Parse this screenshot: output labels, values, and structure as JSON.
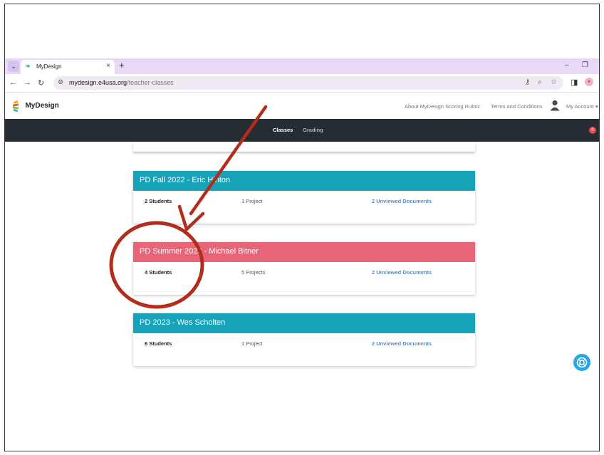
{
  "browser": {
    "tab_title": "MyDesign",
    "url_domain": "mydesign.e4usa.org",
    "url_path": "/teacher-classes",
    "new_tab": "+",
    "close_tab": "×",
    "tab_list": "⌄"
  },
  "site": {
    "logo_text": "MyDesign",
    "header_links": [
      "About MyDesign Scoring Rubric",
      "Terms and Conditions"
    ],
    "account_label": "My Account ▾"
  },
  "nav": {
    "classes": "Classes",
    "grading": "Grading",
    "notification_count": "0"
  },
  "classes": [
    {
      "name": "PD Fall 2022 - Eric Hinton",
      "students": "2 Students",
      "projects": "1 Project",
      "docs": "2 Unviewed Documents",
      "color": "#17a2b8"
    },
    {
      "name": "PD Summer 2023 - Michael Bitner",
      "students": "4 Students",
      "projects": "5 Projects",
      "docs": "2 Unviewed Documents",
      "color": "#e66677"
    },
    {
      "name": "PD 2023 - Wes Scholten",
      "students": "6 Students",
      "projects": "1 Project",
      "docs": "2 Unviewed Documents",
      "color": "#17a2b8"
    }
  ],
  "annotation": {
    "color": "#b32d1c",
    "shape": "arrow-and-circle"
  },
  "colors": {
    "navbar": "#252c33",
    "nav_active": "#ffffff",
    "nav_inactive": "#a9b1b8",
    "link": "#5a8fc4",
    "help": "#28a4e8"
  },
  "icons": [
    "tab-list-icon",
    "favicon-icon",
    "close-icon",
    "back-icon",
    "forward-icon",
    "reload-icon",
    "site-info-icon",
    "password-key-icon",
    "zoom-icon",
    "star-icon",
    "side-panel-icon",
    "profile-icon",
    "user-avatar-icon",
    "help-lifebuoy-icon"
  ]
}
